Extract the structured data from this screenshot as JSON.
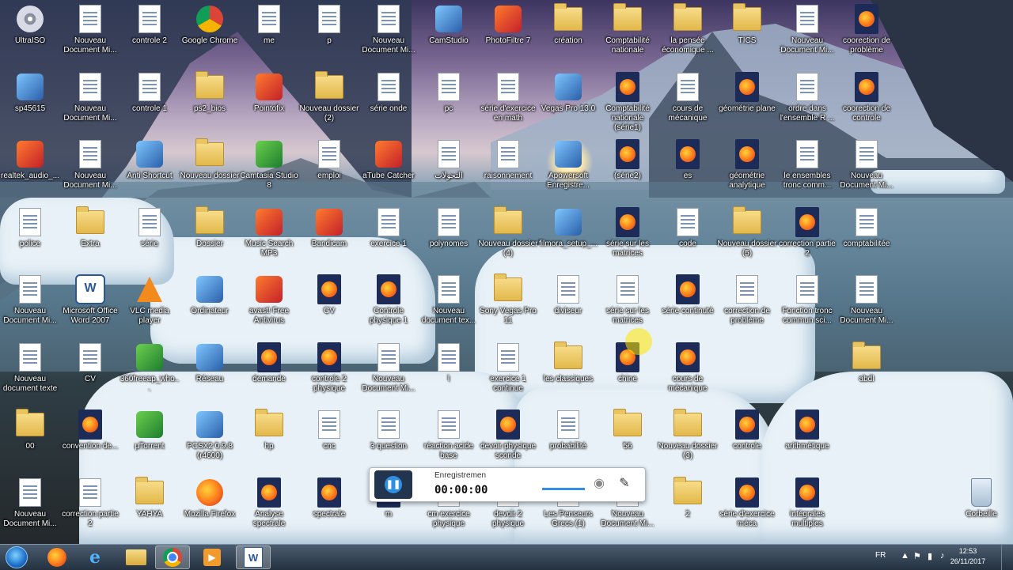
{
  "desktop": {
    "icons": [
      {
        "label": "UltraISO",
        "type": "disc",
        "x": 0,
        "y": 6
      },
      {
        "label": "Nouveau Document Mi...",
        "type": "doc",
        "x": 1,
        "y": 6
      },
      {
        "label": "controle 2",
        "type": "doc",
        "x": 2,
        "y": 6
      },
      {
        "label": "Google Chrome",
        "type": "chrome",
        "x": 3,
        "y": 6
      },
      {
        "label": "me",
        "type": "doc",
        "x": 4,
        "y": 6
      },
      {
        "label": "p",
        "type": "doc",
        "x": 5,
        "y": 6
      },
      {
        "label": "Nouveau Document Mi...",
        "type": "doc",
        "x": 6,
        "y": 6
      },
      {
        "label": "CamStudio",
        "type": "app",
        "x": 7,
        "y": 6
      },
      {
        "label": "PhotoFiltre 7",
        "type": "app2",
        "x": 8,
        "y": 6
      },
      {
        "label": "création",
        "type": "folder",
        "x": 9,
        "y": 6
      },
      {
        "label": "Comptabilité nationale",
        "type": "folder",
        "x": 10,
        "y": 6
      },
      {
        "label": "la pensée économique ...",
        "type": "folder",
        "x": 11,
        "y": 6
      },
      {
        "label": "TICS",
        "type": "folder",
        "x": 12,
        "y": 6
      },
      {
        "label": "Nouveau Document Mi...",
        "type": "doc",
        "x": 13,
        "y": 6
      },
      {
        "label": "coorection de problème",
        "type": "ff",
        "x": 14,
        "y": 6
      },
      {
        "label": "sp45615",
        "type": "app",
        "x": 0,
        "y": 1
      },
      {
        "label": "Nouveau Document Mi...",
        "type": "doc",
        "x": 1,
        "y": 1
      },
      {
        "label": "controle 1",
        "type": "doc",
        "x": 2,
        "y": 1
      },
      {
        "label": "ps2_bios",
        "type": "folder",
        "x": 3,
        "y": 1
      },
      {
        "label": "Pointofix",
        "type": "app2",
        "x": 4,
        "y": 1
      },
      {
        "label": "Nouveau dossier (2)",
        "type": "folder",
        "x": 5,
        "y": 1
      },
      {
        "label": "série onde",
        "type": "doc",
        "x": 6,
        "y": 1
      },
      {
        "label": "pc",
        "type": "doc",
        "x": 7,
        "y": 1
      },
      {
        "label": "série d'exercice en math",
        "type": "doc",
        "x": 8,
        "y": 1
      },
      {
        "label": "Vegas Pro 13.0",
        "type": "app",
        "x": 9,
        "y": 1
      },
      {
        "label": "Comptabilité nationale (série1)",
        "type": "ff",
        "x": 10,
        "y": 1
      },
      {
        "label": "cours de mécanique",
        "type": "doc",
        "x": 11,
        "y": 1
      },
      {
        "label": "géométrie plane",
        "type": "ff",
        "x": 12,
        "y": 1
      },
      {
        "label": "ordre dans l'ensemble R ...",
        "type": "doc",
        "x": 13,
        "y": 1
      },
      {
        "label": "coorection de controle",
        "type": "ff",
        "x": 14,
        "y": 1
      },
      {
        "label": "realtek_audio_...",
        "type": "app2",
        "x": 0,
        "y": 2
      },
      {
        "label": "Nouveau Document Mi...",
        "type": "doc",
        "x": 1,
        "y": 2
      },
      {
        "label": "Anti Shortcut",
        "type": "app",
        "x": 2,
        "y": 2
      },
      {
        "label": "Nouveau dossier",
        "type": "folder",
        "x": 3,
        "y": 2
      },
      {
        "label": "Camtasia Studio 8",
        "type": "app3",
        "x": 4,
        "y": 2
      },
      {
        "label": "emploi",
        "type": "doc",
        "x": 5,
        "y": 2
      },
      {
        "label": "aTube Catcher",
        "type": "app2",
        "x": 6,
        "y": 2
      },
      {
        "label": "التحولات",
        "type": "doc",
        "x": 7,
        "y": 2
      },
      {
        "label": "raisonnement",
        "type": "doc",
        "x": 8,
        "y": 2
      },
      {
        "label": "Apowersoft Enregistre...",
        "type": "app",
        "x": 9,
        "y": 2
      },
      {
        "label": "(série2)",
        "type": "ff",
        "x": 10,
        "y": 2
      },
      {
        "label": "es",
        "type": "ff",
        "x": 11,
        "y": 2
      },
      {
        "label": "géométrie analytique",
        "type": "ff",
        "x": 12,
        "y": 2
      },
      {
        "label": "le ensembles tronc comm...",
        "type": "doc",
        "x": 13,
        "y": 2
      },
      {
        "label": "Nouveau Document Mi...",
        "type": "doc",
        "x": 14,
        "y": 2
      },
      {
        "label": "police",
        "type": "doc",
        "x": 0,
        "y": 3
      },
      {
        "label": "Extra",
        "type": "folder",
        "x": 1,
        "y": 3
      },
      {
        "label": "série",
        "type": "doc",
        "x": 2,
        "y": 3
      },
      {
        "label": "Dossier",
        "type": "folder",
        "x": 3,
        "y": 3
      },
      {
        "label": "Music Search MP3",
        "type": "app2",
        "x": 4,
        "y": 3
      },
      {
        "label": "Bandicam",
        "type": "app2",
        "x": 5,
        "y": 3
      },
      {
        "label": "exercice 1",
        "type": "doc",
        "x": 6,
        "y": 3
      },
      {
        "label": "polynomes",
        "type": "doc",
        "x": 7,
        "y": 3
      },
      {
        "label": "Nouveau dossier (4)",
        "type": "folder",
        "x": 8,
        "y": 3
      },
      {
        "label": "filmora_setup_...",
        "type": "app",
        "x": 9,
        "y": 3
      },
      {
        "label": "série sur les matrices",
        "type": "ff",
        "x": 10,
        "y": 3
      },
      {
        "label": "code",
        "type": "doc",
        "x": 11,
        "y": 3
      },
      {
        "label": "Nouveau dossier (5)",
        "type": "folder",
        "x": 12,
        "y": 3
      },
      {
        "label": "correction partie 2",
        "type": "ff",
        "x": 13,
        "y": 3
      },
      {
        "label": "comptabilitée",
        "type": "doc",
        "x": 14,
        "y": 3
      },
      {
        "label": "Nouveau Document Mi...",
        "type": "doc",
        "x": 0,
        "y": 4
      },
      {
        "label": "Microsoft Office Word 2007",
        "type": "word",
        "x": 1,
        "y": 4
      },
      {
        "label": "VLC media player",
        "type": "vlc",
        "x": 2,
        "y": 4
      },
      {
        "label": "Ordinateur",
        "type": "app",
        "x": 3,
        "y": 4
      },
      {
        "label": "avast! Free Antivirus",
        "type": "app2",
        "x": 4,
        "y": 4
      },
      {
        "label": "CV",
        "type": "ff",
        "x": 5,
        "y": 4
      },
      {
        "label": "Controle physique 1",
        "type": "ff",
        "x": 6,
        "y": 4
      },
      {
        "label": "Nouveau document tex...",
        "type": "doc",
        "x": 7,
        "y": 4
      },
      {
        "label": "Sony Vegas Pro 11",
        "type": "folder",
        "x": 8,
        "y": 4
      },
      {
        "label": "diviseur",
        "type": "doc",
        "x": 9,
        "y": 4
      },
      {
        "label": "série sur les matrices",
        "type": "doc",
        "x": 10,
        "y": 4
      },
      {
        "label": "série continuté",
        "type": "ff",
        "x": 11,
        "y": 4
      },
      {
        "label": "correction de problème",
        "type": "doc",
        "x": 12,
        "y": 4
      },
      {
        "label": "Fonction tronc commun sci...",
        "type": "doc",
        "x": 13,
        "y": 4
      },
      {
        "label": "Nouveau Document Mi...",
        "type": "doc",
        "x": 14,
        "y": 4
      },
      {
        "label": "Nouveau document texte",
        "type": "doc",
        "x": 0,
        "y": 5
      },
      {
        "label": "CV",
        "type": "doc",
        "x": 1,
        "y": 5
      },
      {
        "label": "360freeap_who...",
        "type": "app3",
        "x": 2,
        "y": 5
      },
      {
        "label": "Réseau",
        "type": "app",
        "x": 3,
        "y": 5
      },
      {
        "label": "demande",
        "type": "ff",
        "x": 4,
        "y": 5
      },
      {
        "label": "controle 2 physique",
        "type": "ff",
        "x": 5,
        "y": 5
      },
      {
        "label": "Nouveau Document Mi...",
        "type": "doc",
        "x": 6,
        "y": 5
      },
      {
        "label": "l",
        "type": "doc",
        "x": 7,
        "y": 5
      },
      {
        "label": "exercice 1 continue",
        "type": "doc",
        "x": 8,
        "y": 5
      },
      {
        "label": "les classiques",
        "type": "folder",
        "x": 9,
        "y": 5
      },
      {
        "label": "chine",
        "type": "ff",
        "x": 10,
        "y": 5
      },
      {
        "label": "cours de mécanique",
        "type": "ff",
        "x": 11,
        "y": 5
      },
      {
        "label": "abdl",
        "type": "folder",
        "x": 14,
        "y": 5
      },
      {
        "label": "00",
        "type": "folder",
        "x": 0,
        "y": 7
      },
      {
        "label": "convention de...",
        "type": "ff",
        "x": 1,
        "y": 7
      },
      {
        "label": "µTorrent",
        "type": "app3",
        "x": 2,
        "y": 7
      },
      {
        "label": "PCSX2 0.9.8 (r4600)",
        "type": "app",
        "x": 3,
        "y": 7
      },
      {
        "label": "hp",
        "type": "folder",
        "x": 4,
        "y": 7
      },
      {
        "label": "cnc",
        "type": "doc",
        "x": 5,
        "y": 7
      },
      {
        "label": "3 question",
        "type": "doc",
        "x": 6,
        "y": 7
      },
      {
        "label": "réaction acide base",
        "type": "doc",
        "x": 7,
        "y": 7
      },
      {
        "label": "devoir physique sconde",
        "type": "ff",
        "x": 8,
        "y": 7
      },
      {
        "label": "probabilité",
        "type": "doc",
        "x": 9,
        "y": 7
      },
      {
        "label": "56",
        "type": "folder",
        "x": 10,
        "y": 7
      },
      {
        "label": "Nouveau dossier (3)",
        "type": "folder",
        "x": 11,
        "y": 7
      },
      {
        "label": "controle",
        "type": "ff",
        "x": 12,
        "y": 7
      },
      {
        "label": "arithmétique",
        "type": "ff",
        "x": 13,
        "y": 7
      },
      {
        "label": "Nouveau Document Mi...",
        "type": "doc",
        "x": 0,
        "y": 8
      },
      {
        "label": "correction partie 2",
        "type": "doc",
        "x": 1,
        "y": 8
      },
      {
        "label": "YAHYA",
        "type": "folder",
        "x": 2,
        "y": 8
      },
      {
        "label": "Mozilla Firefox",
        "type": "firefox",
        "x": 3,
        "y": 8
      },
      {
        "label": "Analyse spectrale",
        "type": "ff",
        "x": 4,
        "y": 8
      },
      {
        "label": "spectrale",
        "type": "ff",
        "x": 5,
        "y": 8
      },
      {
        "label": "m",
        "type": "ff",
        "x": 6,
        "y": 8
      },
      {
        "label": "cm exercice physique",
        "type": "doc",
        "x": 7,
        "y": 8
      },
      {
        "label": "devoir 2 physique",
        "type": "doc",
        "x": 8,
        "y": 8
      },
      {
        "label": "Les Penseurs Grecs (1)",
        "type": "doc",
        "x": 9,
        "y": 8
      },
      {
        "label": "Nouveau Document Mi...",
        "type": "doc",
        "x": 10,
        "y": 8
      },
      {
        "label": "2",
        "type": "folder",
        "x": 11,
        "y": 8
      },
      {
        "label": "série d'exercice méca",
        "type": "ff",
        "x": 12,
        "y": 8
      },
      {
        "label": "intégrales multiples",
        "type": "ff",
        "x": 13,
        "y": 8
      },
      {
        "label": "Corbeille",
        "type": "bin",
        "x": 16,
        "y": 8
      }
    ]
  },
  "recorder": {
    "title": "Enregistremen",
    "time": "00:00:00",
    "pause_icon": "pause-icon",
    "webcam_icon": "webcam-icon",
    "pen_icon": "pen-icon"
  },
  "taskbar": {
    "pinned": [
      "start-orb",
      "firefox-icon",
      "internet-explorer-icon",
      "file-explorer-icon",
      "chrome-icon",
      "media-player-icon",
      "word-icon"
    ],
    "language": "FR",
    "time": "12:53",
    "date": "26/11/2017"
  }
}
